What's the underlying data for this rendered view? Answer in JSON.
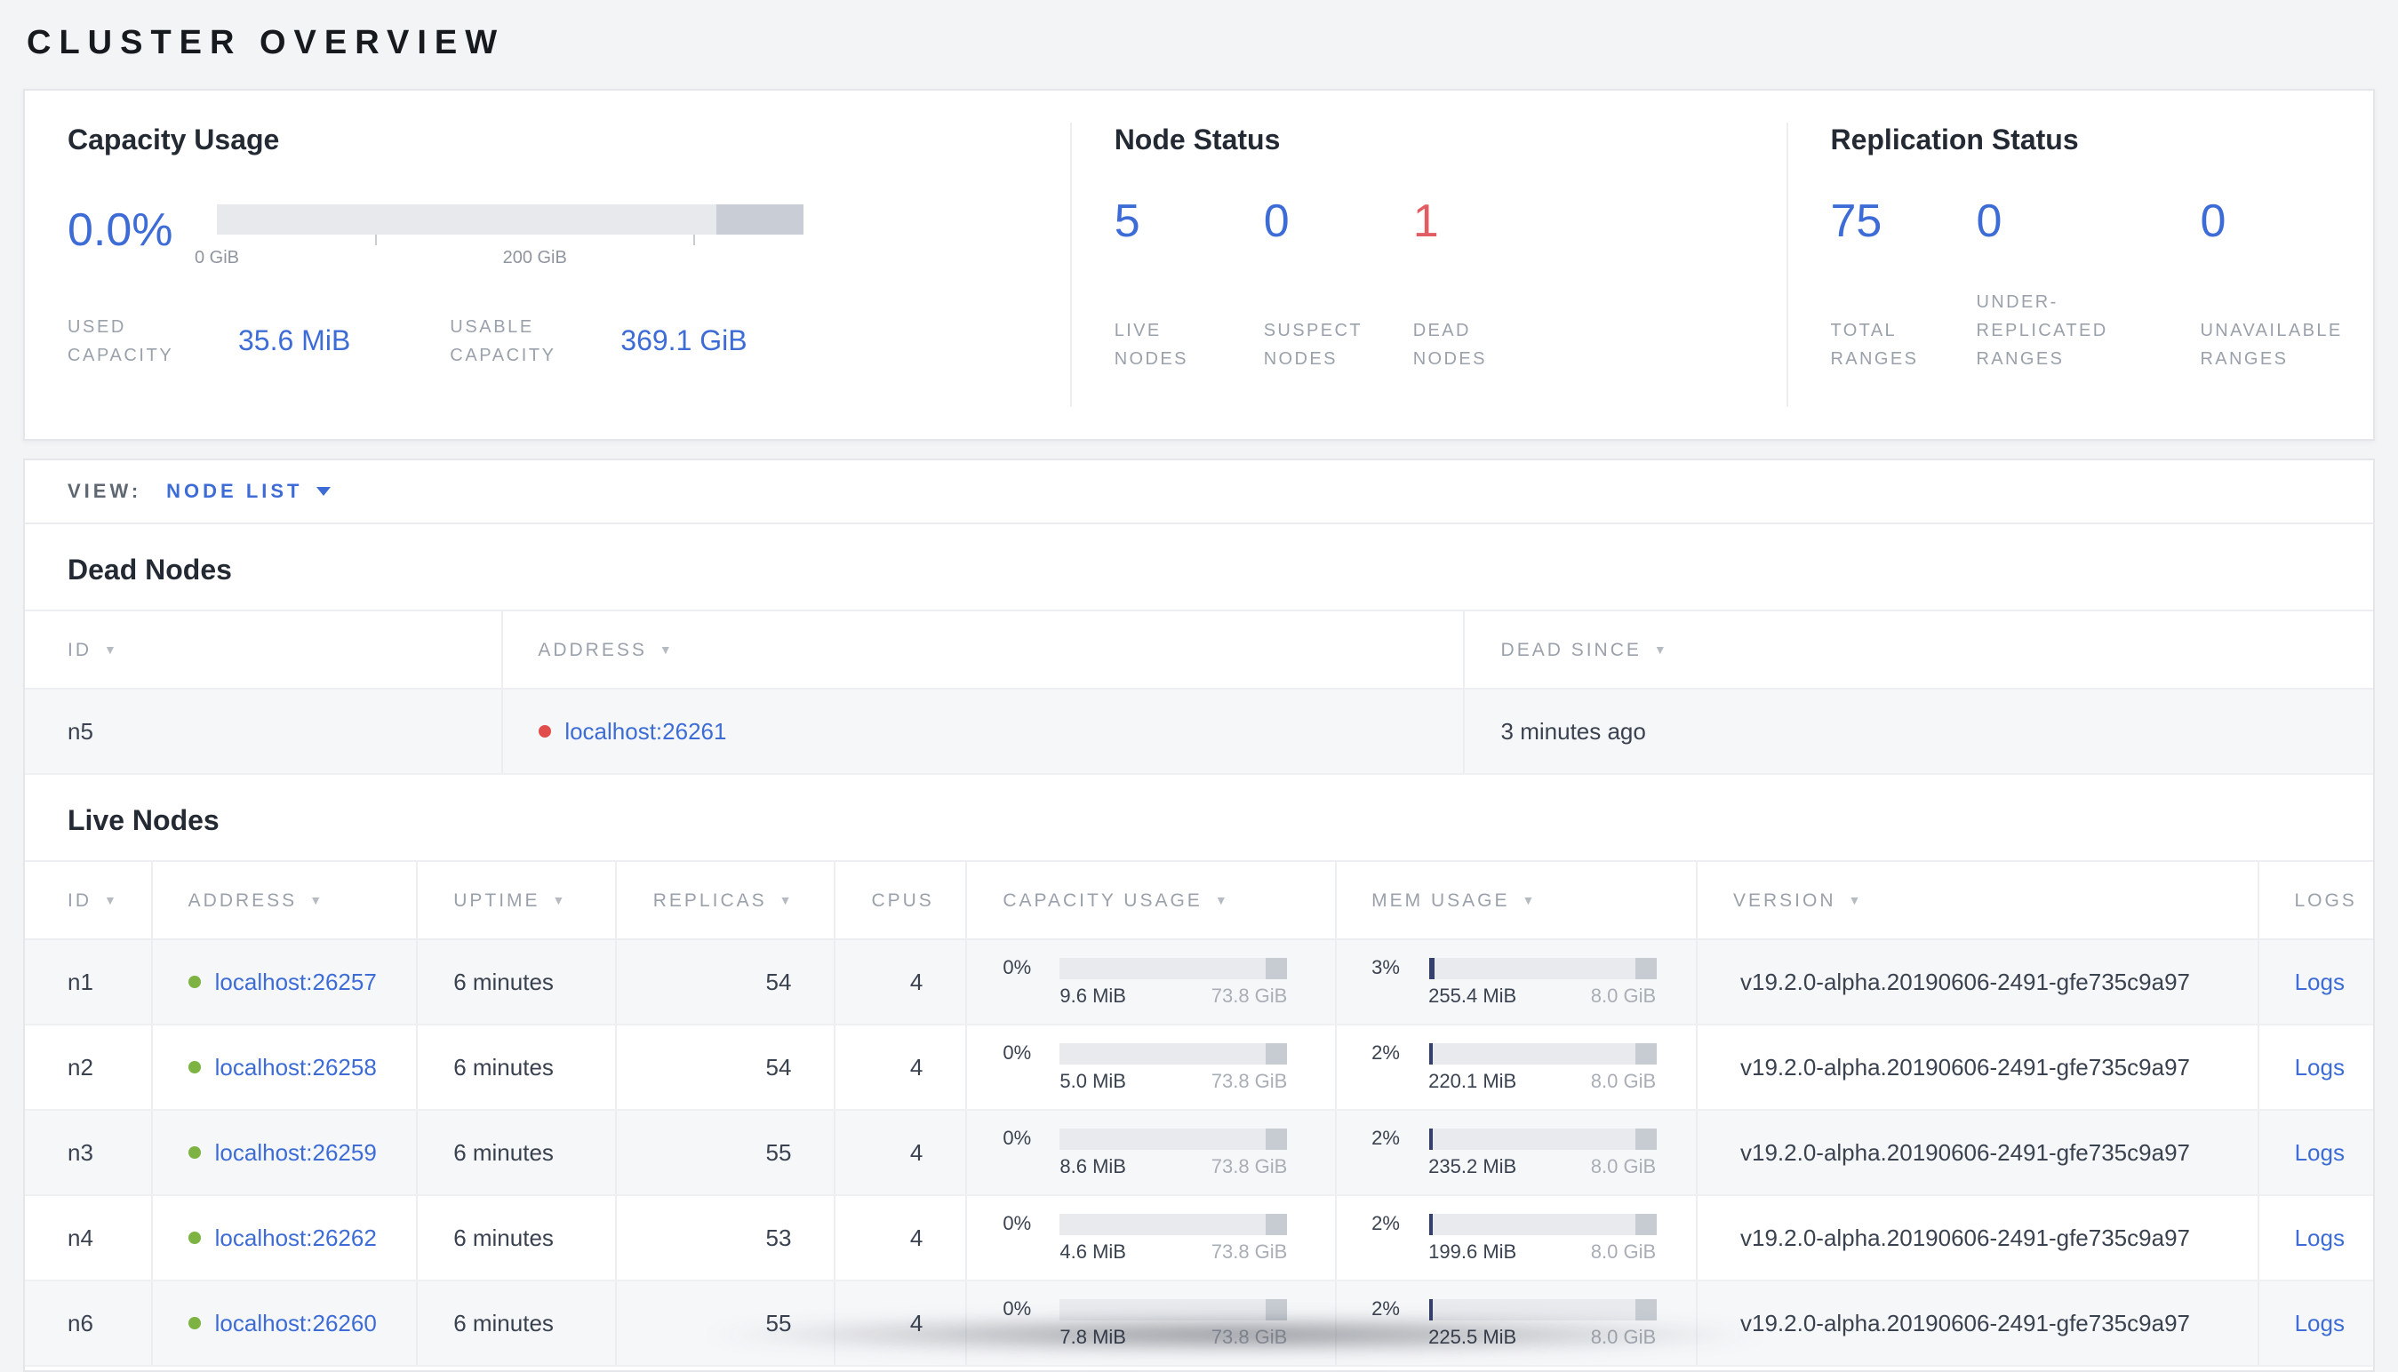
{
  "page": {
    "title": "CLUSTER OVERVIEW"
  },
  "colors": {
    "accent_blue": "#3d6cd7",
    "dead_red": "#e25c63",
    "live_green": "#7cb342",
    "bar_track": "#e8eaee",
    "bar_end": "#c7ccd3",
    "mem_fill": "#34406b",
    "background": "#f3f4f6"
  },
  "summary": {
    "capacity": {
      "title": "Capacity Usage",
      "percent": "0.0%",
      "axis": {
        "start": "0 GiB",
        "mid": "200 GiB"
      },
      "used_label": "USED\nCAPACITY",
      "used_value": "35.6 MiB",
      "usable_label": "USABLE\nCAPACITY",
      "usable_value": "369.1 GiB"
    },
    "node_status": {
      "title": "Node Status",
      "stats": [
        {
          "value": "5",
          "label": "LIVE\nNODES"
        },
        {
          "value": "0",
          "label": "SUSPECT\nNODES"
        },
        {
          "value": "1",
          "label": "DEAD\nNODES"
        }
      ]
    },
    "replication": {
      "title": "Replication Status",
      "stats": [
        {
          "value": "75",
          "label": "TOTAL\nRANGES"
        },
        {
          "value": "0",
          "label": "UNDER-\nREPLICATED\nRANGES"
        },
        {
          "value": "0",
          "label": "UNAVAILABLE\nRANGES"
        }
      ]
    }
  },
  "view_bar": {
    "label": "VIEW:",
    "selected": "NODE LIST"
  },
  "dead_nodes": {
    "heading": "Dead Nodes",
    "columns": [
      {
        "label": "ID"
      },
      {
        "label": "ADDRESS"
      },
      {
        "label": "DEAD SINCE"
      }
    ],
    "rows": [
      {
        "id": "n5",
        "address": "localhost:26261",
        "dead_since": "3 minutes ago"
      }
    ]
  },
  "live_nodes": {
    "heading": "Live Nodes",
    "columns": [
      {
        "label": "ID"
      },
      {
        "label": "ADDRESS"
      },
      {
        "label": "UPTIME"
      },
      {
        "label": "REPLICAS"
      },
      {
        "label": "CPUS"
      },
      {
        "label": "CAPACITY USAGE"
      },
      {
        "label": "MEM USAGE"
      },
      {
        "label": "VERSION"
      },
      {
        "label": "LOGS"
      }
    ],
    "rows": [
      {
        "id": "n1",
        "address": "localhost:26257",
        "uptime": "6 minutes",
        "replicas": "54",
        "cpus": "4",
        "capacity": {
          "percent": "0%",
          "used": "9.6 MiB",
          "total": "73.8 GiB",
          "fill_style": "width:0%"
        },
        "mem": {
          "percent": "3%",
          "used": "255.4 MiB",
          "total": "8.0 GiB",
          "fill_style": "width:3%"
        },
        "version": "v19.2.0-alpha.20190606-2491-gfe735c9a97",
        "logs": "Logs"
      },
      {
        "id": "n2",
        "address": "localhost:26258",
        "uptime": "6 minutes",
        "replicas": "54",
        "cpus": "4",
        "capacity": {
          "percent": "0%",
          "used": "5.0 MiB",
          "total": "73.8 GiB",
          "fill_style": "width:0%"
        },
        "mem": {
          "percent": "2%",
          "used": "220.1 MiB",
          "total": "8.0 GiB",
          "fill_style": "width:2%"
        },
        "version": "v19.2.0-alpha.20190606-2491-gfe735c9a97",
        "logs": "Logs"
      },
      {
        "id": "n3",
        "address": "localhost:26259",
        "uptime": "6 minutes",
        "replicas": "55",
        "cpus": "4",
        "capacity": {
          "percent": "0%",
          "used": "8.6 MiB",
          "total": "73.8 GiB",
          "fill_style": "width:0%"
        },
        "mem": {
          "percent": "2%",
          "used": "235.2 MiB",
          "total": "8.0 GiB",
          "fill_style": "width:2%"
        },
        "version": "v19.2.0-alpha.20190606-2491-gfe735c9a97",
        "logs": "Logs"
      },
      {
        "id": "n4",
        "address": "localhost:26262",
        "uptime": "6 minutes",
        "replicas": "53",
        "cpus": "4",
        "capacity": {
          "percent": "0%",
          "used": "4.6 MiB",
          "total": "73.8 GiB",
          "fill_style": "width:0%"
        },
        "mem": {
          "percent": "2%",
          "used": "199.6 MiB",
          "total": "8.0 GiB",
          "fill_style": "width:2%"
        },
        "version": "v19.2.0-alpha.20190606-2491-gfe735c9a97",
        "logs": "Logs"
      },
      {
        "id": "n6",
        "address": "localhost:26260",
        "uptime": "6 minutes",
        "replicas": "55",
        "cpus": "4",
        "capacity": {
          "percent": "0%",
          "used": "7.8 MiB",
          "total": "73.8 GiB",
          "fill_style": "width:0%"
        },
        "mem": {
          "percent": "2%",
          "used": "225.5 MiB",
          "total": "8.0 GiB",
          "fill_style": "width:2%"
        },
        "version": "v19.2.0-alpha.20190606-2491-gfe735c9a97",
        "logs": "Logs"
      }
    ]
  }
}
